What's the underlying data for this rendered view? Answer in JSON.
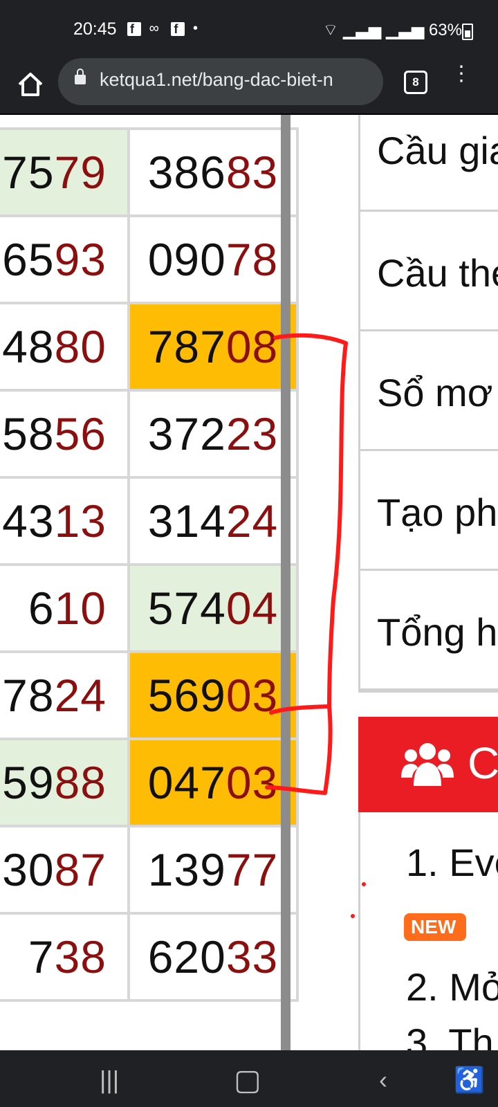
{
  "status_bar": {
    "time": "20:45",
    "notif_icons": [
      "facebook-icon",
      "link-icon",
      "facebook-icon",
      "dot-icon"
    ],
    "battery": "63%"
  },
  "browser": {
    "url": "ketqua1.net/bang-dac-biet-n",
    "tab_count": "8"
  },
  "table": {
    "rows": [
      {
        "c1": {
          "plain": "75",
          "red": "79",
          "bg": "green"
        },
        "c2": {
          "plain": "386",
          "red": "83",
          "bg": ""
        }
      },
      {
        "c1": {
          "plain": "65",
          "red": "93",
          "bg": ""
        },
        "c2": {
          "plain": "090",
          "red": "78",
          "bg": ""
        }
      },
      {
        "c1": {
          "plain": "48",
          "red": "80",
          "bg": ""
        },
        "c2": {
          "plain": "787",
          "red": "08",
          "bg": "yellow"
        }
      },
      {
        "c1": {
          "plain": "58",
          "red": "56",
          "bg": ""
        },
        "c2": {
          "plain": "372",
          "red": "23",
          "bg": ""
        }
      },
      {
        "c1": {
          "plain": "43",
          "red": "13",
          "bg": ""
        },
        "c2": {
          "plain": "314",
          "red": "24",
          "bg": ""
        }
      },
      {
        "c1": {
          "plain": "6",
          "red": "10",
          "bg": ""
        },
        "c2": {
          "plain": "574",
          "red": "04",
          "bg": "green"
        }
      },
      {
        "c1": {
          "plain": "78",
          "red": "24",
          "bg": ""
        },
        "c2": {
          "plain": "569",
          "red": "03",
          "bg": "yellow"
        }
      },
      {
        "c1": {
          "plain": "59",
          "red": "88",
          "bg": "green"
        },
        "c2": {
          "plain": "047",
          "red": "03",
          "bg": "yellow"
        }
      },
      {
        "c1": {
          "plain": "30",
          "red": "87",
          "bg": ""
        },
        "c2": {
          "plain": "139",
          "red": "77",
          "bg": ""
        }
      },
      {
        "c1": {
          "plain": "7",
          "red": "38",
          "bg": ""
        },
        "c2": {
          "plain": "620",
          "red": "33",
          "bg": ""
        }
      }
    ]
  },
  "side_menu": {
    "items": [
      "Cầu gia",
      "Cầu the",
      "Sổ mơ",
      "Tạo ph",
      "Tổng h"
    ]
  },
  "section_header": {
    "icon": "users-icon",
    "label": "C"
  },
  "list": {
    "item1": "1. Eve",
    "badge": "NEW",
    "item2": "2. Mở",
    "item3": "3. Th"
  },
  "colors": {
    "highlight_yellow": "#ffbc05",
    "highlight_green": "#e2f0dc",
    "digit_red": "#8b0f0f",
    "header_red": "#ea1c24",
    "scribble_red": "#ff1a1a"
  }
}
